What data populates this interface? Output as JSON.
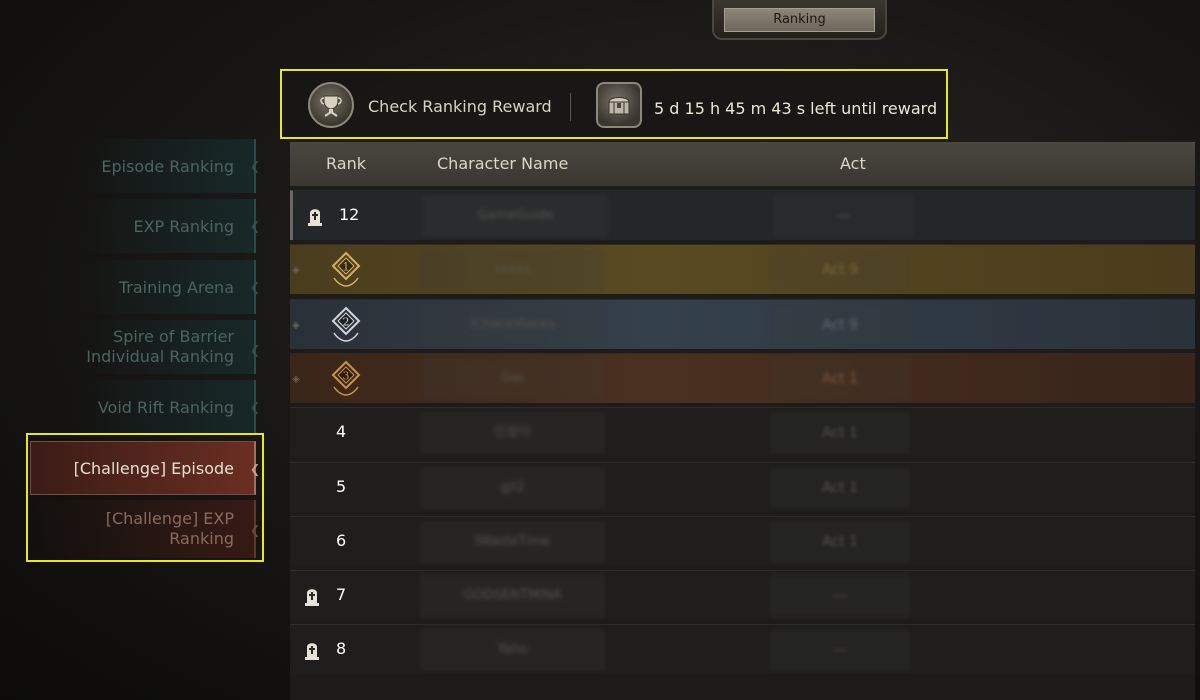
{
  "header": {
    "title": "Ranking"
  },
  "reward_bar": {
    "check_label": "Check Ranking Reward",
    "timer_text": "5 d 15 h 45 m 43 s left until reward"
  },
  "sidebar": {
    "items": [
      {
        "label": "Episode Ranking"
      },
      {
        "label": "EXP Ranking"
      },
      {
        "label": "Training Arena"
      },
      {
        "label_line1": "Spire of Barrier",
        "label_line2": "Individual Ranking"
      },
      {
        "label": "Void Rift Ranking"
      },
      {
        "label": "[Challenge] Episode"
      },
      {
        "label_line1": "[Challenge] EXP",
        "label_line2": "Ranking"
      }
    ]
  },
  "table": {
    "columns": {
      "rank": "Rank",
      "name": "Character Name",
      "act": "Act"
    },
    "rows": [
      {
        "rank": "12",
        "name": "GameGuide",
        "act": "—",
        "style": "mine",
        "icon": "tombstone-icon"
      },
      {
        "rank": "1",
        "name": "xxxxx",
        "act": "Act 9",
        "style": "gold",
        "icon": "gold-medal-icon"
      },
      {
        "rank": "2",
        "name": "ICheckVoices",
        "act": "Act 9",
        "style": "silver",
        "icon": "silver-medal-icon"
      },
      {
        "rank": "3",
        "name": "Gwi",
        "act": "Act 1",
        "style": "bronze",
        "icon": "bronze-medal-icon"
      },
      {
        "rank": "4",
        "name": "인정이",
        "act": "Act 1",
        "style": "normal",
        "icon": ""
      },
      {
        "rank": "5",
        "name": "gil2",
        "act": "Act 1",
        "style": "normal",
        "icon": ""
      },
      {
        "rank": "6",
        "name": "IWasteTime",
        "act": "Act 1",
        "style": "normal",
        "icon": ""
      },
      {
        "rank": "7",
        "name": "GODSENTMINA",
        "act": "—",
        "style": "normal",
        "icon": "tombstone-icon"
      },
      {
        "rank": "8",
        "name": "Yaho",
        "act": "—",
        "style": "normal",
        "icon": "tombstone-icon"
      }
    ]
  },
  "colors": {
    "highlight": "#e8e81f",
    "gold": "#c9a34a",
    "silver": "#c8ccd0",
    "bronze": "#c58a4a"
  }
}
